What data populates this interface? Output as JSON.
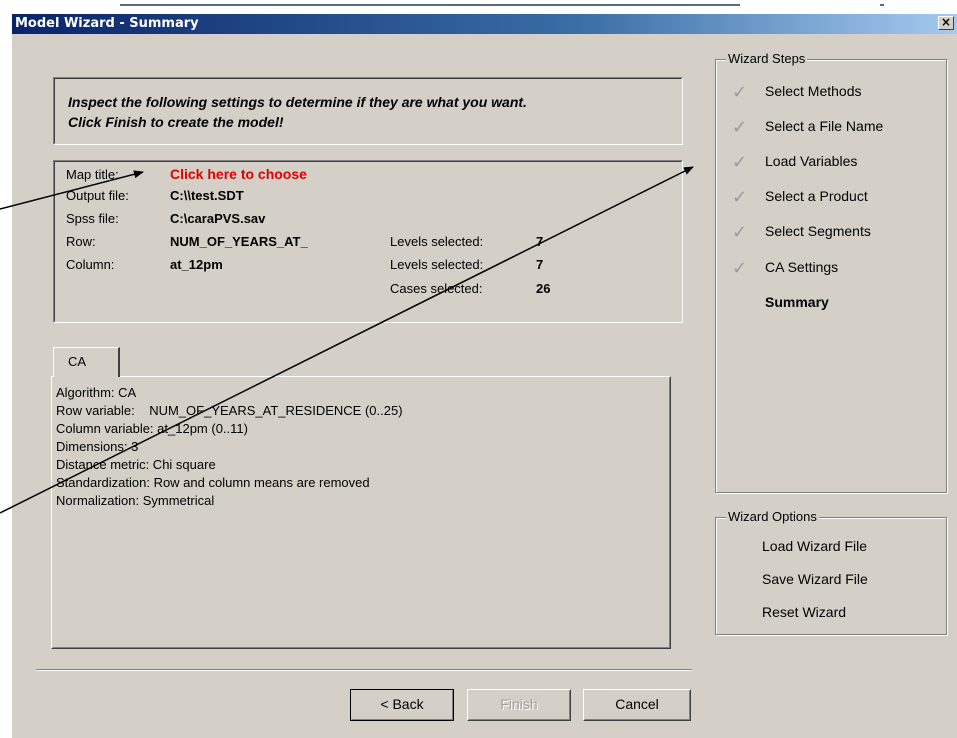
{
  "window": {
    "title": "Model Wizard - Summary",
    "close_glyph": "×"
  },
  "instructions": {
    "line1": "Inspect the following settings to determine if they are what you want.",
    "line2": "Click Finish to create the model!"
  },
  "settings": {
    "map_title_label": "Map title:",
    "map_title_value": "Click here to choose",
    "output_file_label": "Output file:",
    "output_file_value": "C:\\\\test.SDT",
    "spss_file_label": "Spss file:",
    "spss_file_value": "C:\\caraPVS.sav",
    "row_label": "Row:",
    "row_value": "NUM_OF_YEARS_AT_",
    "row_levels_label": "Levels selected:",
    "row_levels_value": "7",
    "column_label": "Column:",
    "column_value": "at_12pm",
    "column_levels_label": "Levels selected:",
    "column_levels_value": "7",
    "cases_label": "Cases selected:",
    "cases_value": "26"
  },
  "tabs": [
    {
      "label": "CA"
    }
  ],
  "ca_details": [
    "Algorithm: CA",
    "Row variable:    NUM_OF_YEARS_AT_RESIDENCE (0..25)",
    "Column variable: at_12pm (0..11)",
    "Dimensions: 3",
    "Distance metric: Chi square",
    "Standardization: Row and column means are removed",
    "Normalization: Symmetrical"
  ],
  "buttons": {
    "back": "< Back",
    "finish": "Finish",
    "cancel": "Cancel"
  },
  "wizard_steps": {
    "title": "Wizard Steps",
    "check_glyph": "✓",
    "items": [
      {
        "label": "Select Methods"
      },
      {
        "label": "Select a File Name"
      },
      {
        "label": "Load Variables"
      },
      {
        "label": "Select a Product"
      },
      {
        "label": "Select Segments"
      },
      {
        "label": "CA Settings"
      },
      {
        "label": "Summary"
      }
    ]
  },
  "wizard_options": {
    "title": "Wizard Options",
    "items": [
      {
        "label": "Load Wizard File"
      },
      {
        "label": "Save Wizard File"
      },
      {
        "label": "Reset Wizard"
      }
    ]
  },
  "colors": {
    "titlebar_start": "#0a246a",
    "titlebar_end": "#a6caf0",
    "face": "#d4d0c8",
    "highlight_red": "#e00000",
    "check_gray": "#9a9a9a"
  }
}
